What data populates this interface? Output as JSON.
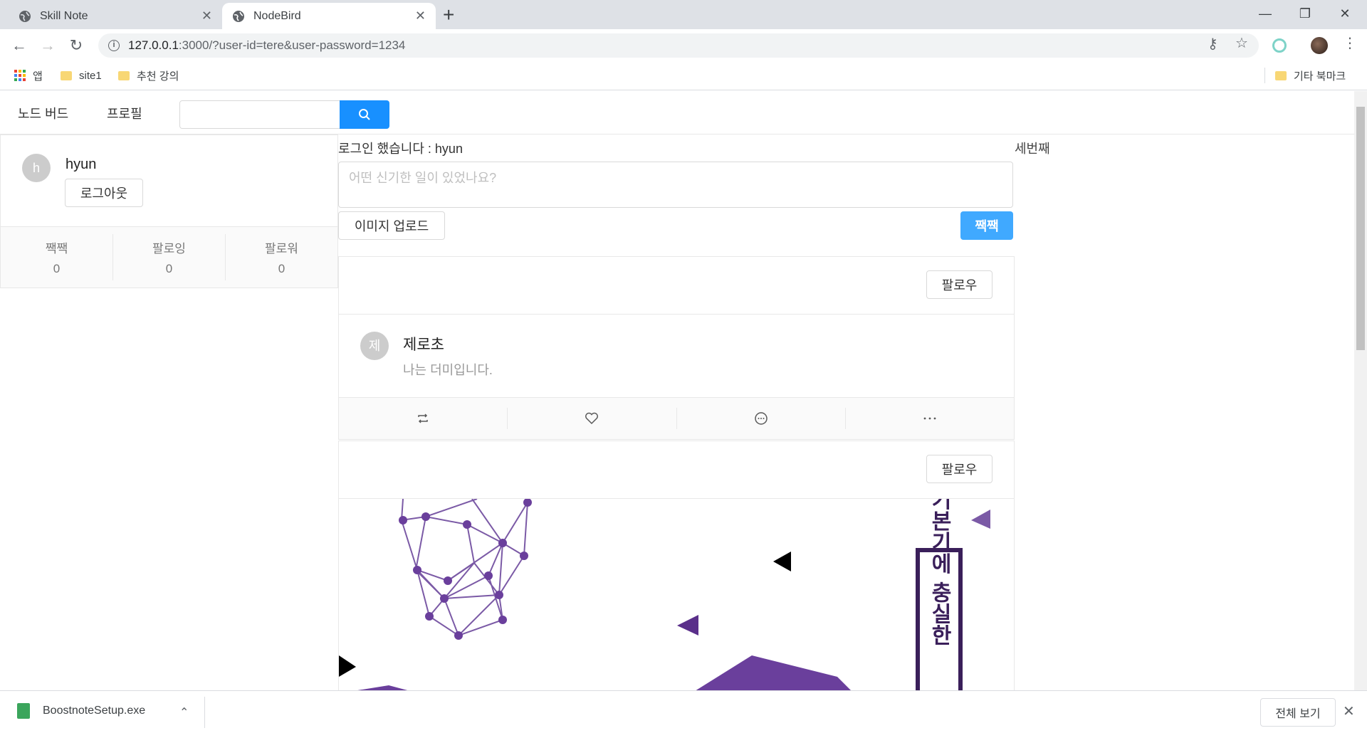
{
  "browser": {
    "tabs": [
      {
        "title": "Skill Note"
      },
      {
        "title": "NodeBird"
      }
    ],
    "url_host": "127.0.0.1",
    "url_path": ":3000/?user-id=tere&user-password=1234",
    "bookmarks": [
      {
        "label": "앱"
      },
      {
        "label": "site1"
      },
      {
        "label": "추천 강의"
      }
    ],
    "other_bookmarks": "기타 북마크"
  },
  "app": {
    "menu": {
      "items": [
        "노드 버드",
        "프로필"
      ],
      "search_placeholder": ""
    },
    "profile": {
      "avatar_letter": "h",
      "nickname": "hyun",
      "logout_label": "로그아웃",
      "stats": [
        {
          "label": "짹짹",
          "value": "0"
        },
        {
          "label": "팔로잉",
          "value": "0"
        },
        {
          "label": "팔로워",
          "value": "0"
        }
      ]
    },
    "login_message": "로그인 했습니다 : hyun",
    "post_form": {
      "placeholder": "어떤 신기한 일이 있었나요?",
      "upload_label": "이미지 업로드",
      "submit_label": "짹짹"
    },
    "posts": [
      {
        "follow_label": "팔로우",
        "avatar_letter": "제",
        "author": "제로초",
        "content": "나는 더미입니다.",
        "actions": [
          "retweet-icon",
          "heart-icon",
          "message-icon",
          "ellipsis-icon"
        ]
      },
      {
        "follow_label": "팔로우",
        "image_text": "기본기에 충실한"
      }
    ],
    "right_column_text": "세번째",
    "accent_color": "#1890ff"
  },
  "download_bar": {
    "file_name": "BoostnoteSetup.exe",
    "show_all_label": "전체 보기"
  }
}
